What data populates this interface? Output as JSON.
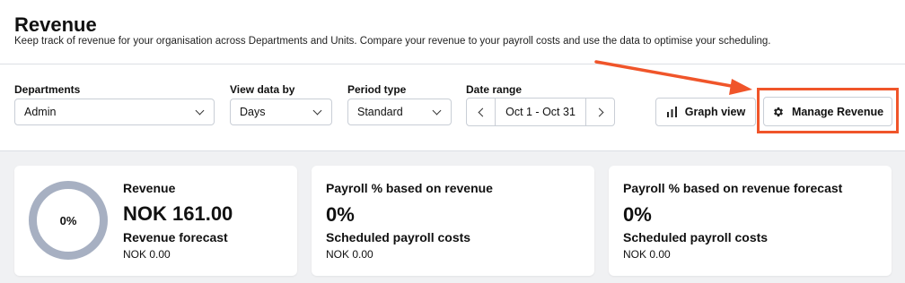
{
  "header": {
    "title": "Revenue",
    "subtitle": "Keep track of revenue for your organisation across Departments and Units. Compare your revenue to your payroll costs and use the data to optimise your scheduling."
  },
  "filters": {
    "departments": {
      "label": "Departments",
      "value": "Admin"
    },
    "view_by": {
      "label": "View data by",
      "value": "Days"
    },
    "period_type": {
      "label": "Period type",
      "value": "Standard"
    },
    "date_range": {
      "label": "Date range",
      "value": "Oct 1 - Oct 31"
    }
  },
  "actions": {
    "graph_view": "Graph view",
    "manage_revenue": "Manage Revenue"
  },
  "cards": {
    "revenue": {
      "ring_percent": "0%",
      "ring_progress": 0,
      "title": "Revenue",
      "value": "NOK 161.00",
      "sub_title": "Revenue forecast",
      "sub_value": "NOK 0.00"
    },
    "payroll": {
      "title": "Payroll % based on revenue",
      "value": "0%",
      "sub_title": "Scheduled payroll costs",
      "sub_value": "NOK 0.00"
    },
    "payroll_forecast": {
      "title": "Payroll % based on revenue forecast",
      "value": "0%",
      "sub_title": "Scheduled payroll costs",
      "sub_value": "NOK 0.00"
    }
  },
  "colors": {
    "annotation": "#f0552a",
    "ring": "#a7b0c2"
  },
  "icons": {
    "graph_view": "bar-chart-icon",
    "manage_revenue": "gear-icon"
  }
}
